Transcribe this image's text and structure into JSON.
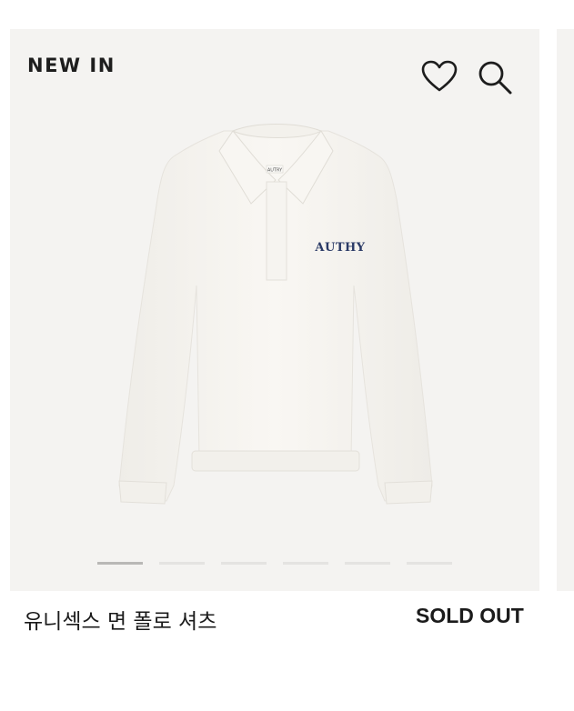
{
  "product_card": {
    "badge": "NEW IN",
    "logo_text": "AUTHY",
    "collar_label": "AUTRY",
    "image_description_icon": "sweatshirt-polo-image",
    "carousel": {
      "count": 6,
      "active_index": 0
    },
    "title": "유니섹스 면 폴로 셔츠",
    "status": "SOLD OUT"
  },
  "icons": {
    "wishlist": "heart-icon",
    "search": "search-icon"
  },
  "colors": {
    "card_bg": "#f4f3f1",
    "text": "#1b1b1b",
    "garment": "#f7f5f1",
    "logo": "#2a3a66"
  }
}
